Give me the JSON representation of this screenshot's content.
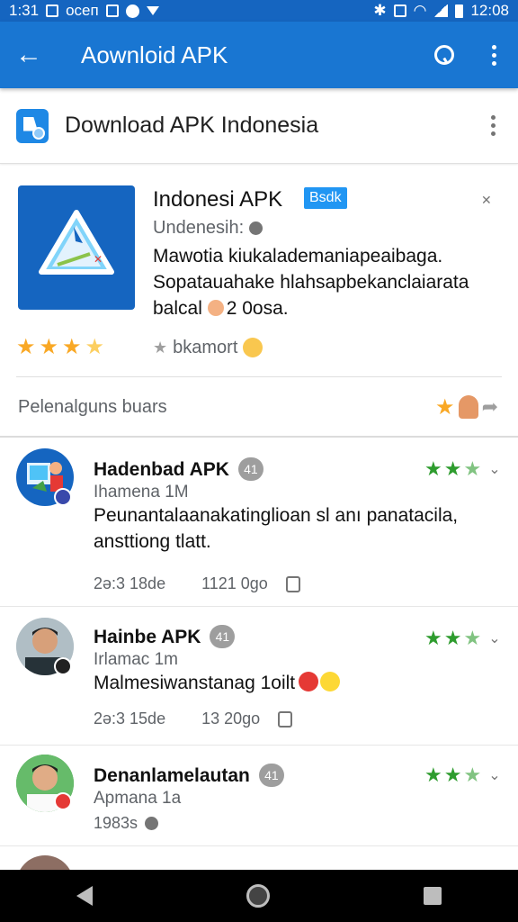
{
  "status_bar": {
    "time_left": "1:31",
    "carrier": "oceп",
    "time_right": "12:08"
  },
  "app_bar": {
    "title": "Aownloid APK"
  },
  "section": {
    "title": "Download APK Indonesia"
  },
  "app": {
    "name": "Indonesi APK",
    "badge": "Bsdk",
    "developer": "Undenesih:",
    "description_line1": "Mawotia kiukalademaniapeaibaga.",
    "description_line2": "Sopatauahake hlahsapbekanclaiarata",
    "description_line3": "balcal",
    "description_suffix": "2 0osa.",
    "rating": 3.5,
    "report_label": "bkamort"
  },
  "reviews_header": {
    "label": "Pelenalguns buars"
  },
  "reviews": [
    {
      "name": "Hadenbad APK",
      "count": "41",
      "subtitle": "Ihamena 1M",
      "text": "Peunantalaanakatinglioan sl anı panatacila, ansttiong tlatt.",
      "meta_left": "2ə:3 18de",
      "meta_right": "1121 0go",
      "stars": 2.5
    },
    {
      "name": "Hainbe APK",
      "count": "41",
      "subtitle": "Irlamac 1m",
      "text": "Malmesiwanstanag 1oilt",
      "meta_left": "2ə:3 15de",
      "meta_right": "13 20go",
      "stars": 2.5
    },
    {
      "name": "Denanlamelautan",
      "count": "41",
      "subtitle": "Apmana 1a",
      "meta_left": "1983s",
      "stars": 2.5
    }
  ],
  "colors": {
    "status_bar": "#1565c0",
    "app_bar": "#1976d2",
    "badge": "#2196f3",
    "review_star": "#2e9c2e",
    "app_star": "#f9a825"
  }
}
